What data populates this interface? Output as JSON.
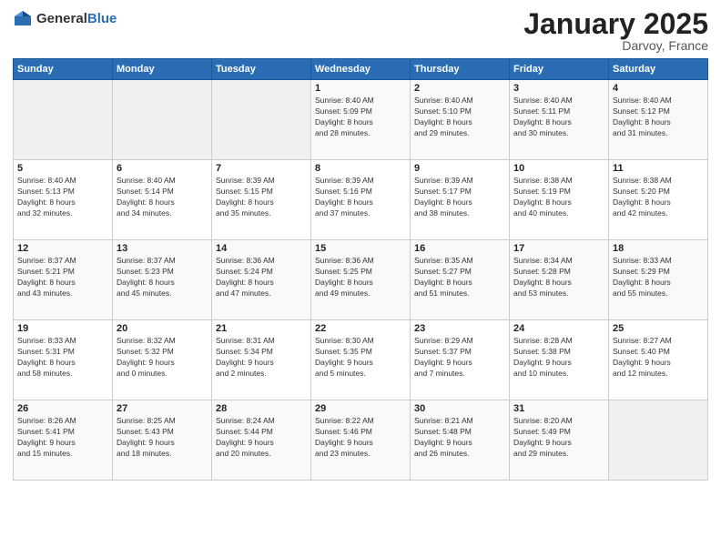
{
  "header": {
    "logo_general": "General",
    "logo_blue": "Blue",
    "month_title": "January 2025",
    "location": "Darvoy, France"
  },
  "weekdays": [
    "Sunday",
    "Monday",
    "Tuesday",
    "Wednesday",
    "Thursday",
    "Friday",
    "Saturday"
  ],
  "weeks": [
    [
      {
        "day": "",
        "info": ""
      },
      {
        "day": "",
        "info": ""
      },
      {
        "day": "",
        "info": ""
      },
      {
        "day": "1",
        "info": "Sunrise: 8:40 AM\nSunset: 5:09 PM\nDaylight: 8 hours\nand 28 minutes."
      },
      {
        "day": "2",
        "info": "Sunrise: 8:40 AM\nSunset: 5:10 PM\nDaylight: 8 hours\nand 29 minutes."
      },
      {
        "day": "3",
        "info": "Sunrise: 8:40 AM\nSunset: 5:11 PM\nDaylight: 8 hours\nand 30 minutes."
      },
      {
        "day": "4",
        "info": "Sunrise: 8:40 AM\nSunset: 5:12 PM\nDaylight: 8 hours\nand 31 minutes."
      }
    ],
    [
      {
        "day": "5",
        "info": "Sunrise: 8:40 AM\nSunset: 5:13 PM\nDaylight: 8 hours\nand 32 minutes."
      },
      {
        "day": "6",
        "info": "Sunrise: 8:40 AM\nSunset: 5:14 PM\nDaylight: 8 hours\nand 34 minutes."
      },
      {
        "day": "7",
        "info": "Sunrise: 8:39 AM\nSunset: 5:15 PM\nDaylight: 8 hours\nand 35 minutes."
      },
      {
        "day": "8",
        "info": "Sunrise: 8:39 AM\nSunset: 5:16 PM\nDaylight: 8 hours\nand 37 minutes."
      },
      {
        "day": "9",
        "info": "Sunrise: 8:39 AM\nSunset: 5:17 PM\nDaylight: 8 hours\nand 38 minutes."
      },
      {
        "day": "10",
        "info": "Sunrise: 8:38 AM\nSunset: 5:19 PM\nDaylight: 8 hours\nand 40 minutes."
      },
      {
        "day": "11",
        "info": "Sunrise: 8:38 AM\nSunset: 5:20 PM\nDaylight: 8 hours\nand 42 minutes."
      }
    ],
    [
      {
        "day": "12",
        "info": "Sunrise: 8:37 AM\nSunset: 5:21 PM\nDaylight: 8 hours\nand 43 minutes."
      },
      {
        "day": "13",
        "info": "Sunrise: 8:37 AM\nSunset: 5:23 PM\nDaylight: 8 hours\nand 45 minutes."
      },
      {
        "day": "14",
        "info": "Sunrise: 8:36 AM\nSunset: 5:24 PM\nDaylight: 8 hours\nand 47 minutes."
      },
      {
        "day": "15",
        "info": "Sunrise: 8:36 AM\nSunset: 5:25 PM\nDaylight: 8 hours\nand 49 minutes."
      },
      {
        "day": "16",
        "info": "Sunrise: 8:35 AM\nSunset: 5:27 PM\nDaylight: 8 hours\nand 51 minutes."
      },
      {
        "day": "17",
        "info": "Sunrise: 8:34 AM\nSunset: 5:28 PM\nDaylight: 8 hours\nand 53 minutes."
      },
      {
        "day": "18",
        "info": "Sunrise: 8:33 AM\nSunset: 5:29 PM\nDaylight: 8 hours\nand 55 minutes."
      }
    ],
    [
      {
        "day": "19",
        "info": "Sunrise: 8:33 AM\nSunset: 5:31 PM\nDaylight: 8 hours\nand 58 minutes."
      },
      {
        "day": "20",
        "info": "Sunrise: 8:32 AM\nSunset: 5:32 PM\nDaylight: 9 hours\nand 0 minutes."
      },
      {
        "day": "21",
        "info": "Sunrise: 8:31 AM\nSunset: 5:34 PM\nDaylight: 9 hours\nand 2 minutes."
      },
      {
        "day": "22",
        "info": "Sunrise: 8:30 AM\nSunset: 5:35 PM\nDaylight: 9 hours\nand 5 minutes."
      },
      {
        "day": "23",
        "info": "Sunrise: 8:29 AM\nSunset: 5:37 PM\nDaylight: 9 hours\nand 7 minutes."
      },
      {
        "day": "24",
        "info": "Sunrise: 8:28 AM\nSunset: 5:38 PM\nDaylight: 9 hours\nand 10 minutes."
      },
      {
        "day": "25",
        "info": "Sunrise: 8:27 AM\nSunset: 5:40 PM\nDaylight: 9 hours\nand 12 minutes."
      }
    ],
    [
      {
        "day": "26",
        "info": "Sunrise: 8:26 AM\nSunset: 5:41 PM\nDaylight: 9 hours\nand 15 minutes."
      },
      {
        "day": "27",
        "info": "Sunrise: 8:25 AM\nSunset: 5:43 PM\nDaylight: 9 hours\nand 18 minutes."
      },
      {
        "day": "28",
        "info": "Sunrise: 8:24 AM\nSunset: 5:44 PM\nDaylight: 9 hours\nand 20 minutes."
      },
      {
        "day": "29",
        "info": "Sunrise: 8:22 AM\nSunset: 5:46 PM\nDaylight: 9 hours\nand 23 minutes."
      },
      {
        "day": "30",
        "info": "Sunrise: 8:21 AM\nSunset: 5:48 PM\nDaylight: 9 hours\nand 26 minutes."
      },
      {
        "day": "31",
        "info": "Sunrise: 8:20 AM\nSunset: 5:49 PM\nDaylight: 9 hours\nand 29 minutes."
      },
      {
        "day": "",
        "info": ""
      }
    ]
  ]
}
